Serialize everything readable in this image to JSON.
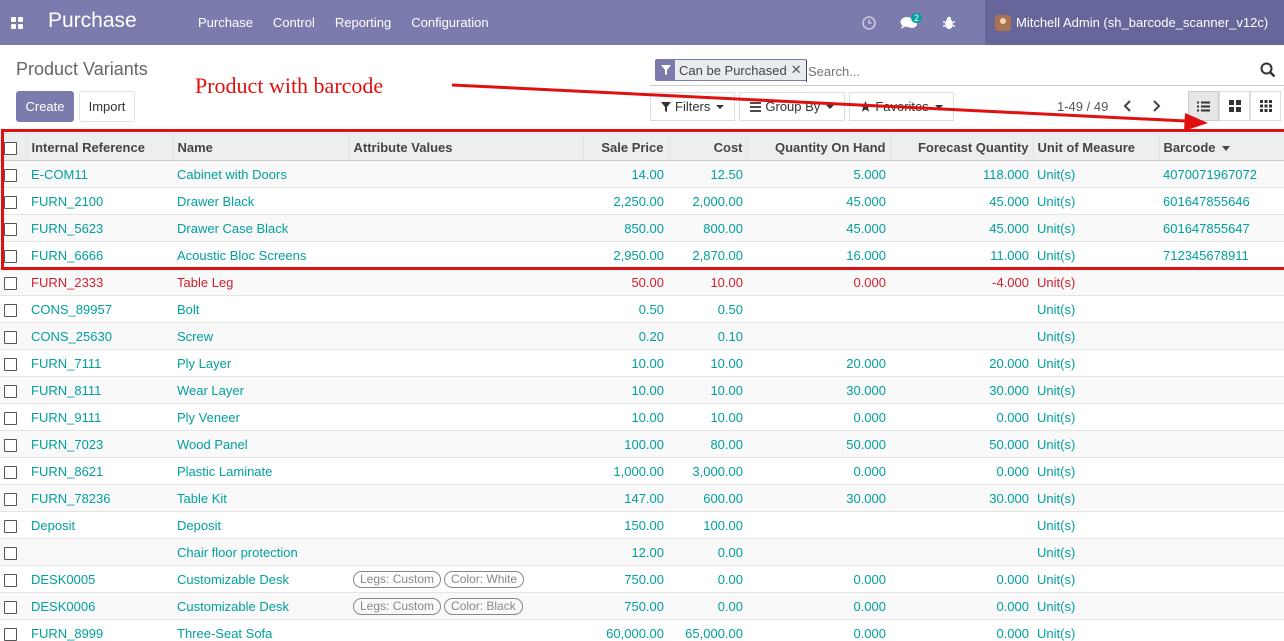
{
  "navbar": {
    "app_title": "Purchase",
    "menu": [
      "Purchase",
      "Control",
      "Reporting",
      "Configuration"
    ],
    "chat_badge": "2",
    "user_name": "Mitchell Admin (sh_barcode_scanner_v12c)",
    "bg_color": "#7c7bad"
  },
  "control_panel": {
    "breadcrumb": "Product Variants",
    "create_label": "Create",
    "import_label": "Import",
    "annotation_text": "Product with barcode",
    "search": {
      "facet": "Can be Purchased",
      "placeholder": "Search..."
    },
    "filters_label": "Filters",
    "group_by_label": "Group By",
    "favorites_label": "Favorites",
    "pager": "1-49 / 49"
  },
  "table": {
    "columns": [
      "Internal Reference",
      "Name",
      "Attribute Values",
      "Sale Price",
      "Cost",
      "Quantity On Hand",
      "Forecast Quantity",
      "Unit of Measure",
      "Barcode"
    ],
    "rows": [
      {
        "ref": "E-COM11",
        "name": "Cabinet with Doors",
        "attrs": [],
        "price": "14.00",
        "cost": "12.50",
        "qoh": "5.000",
        "forecast": "118.000",
        "uom": "Unit(s)",
        "barcode": "4070071967072",
        "danger": false
      },
      {
        "ref": "FURN_2100",
        "name": "Drawer Black",
        "attrs": [],
        "price": "2,250.00",
        "cost": "2,000.00",
        "qoh": "45.000",
        "forecast": "45.000",
        "uom": "Unit(s)",
        "barcode": "601647855646",
        "danger": false
      },
      {
        "ref": "FURN_5623",
        "name": "Drawer Case Black",
        "attrs": [],
        "price": "850.00",
        "cost": "800.00",
        "qoh": "45.000",
        "forecast": "45.000",
        "uom": "Unit(s)",
        "barcode": "601647855647",
        "danger": false
      },
      {
        "ref": "FURN_6666",
        "name": "Acoustic Bloc Screens",
        "attrs": [],
        "price": "2,950.00",
        "cost": "2,870.00",
        "qoh": "16.000",
        "forecast": "11.000",
        "uom": "Unit(s)",
        "barcode": "712345678911",
        "danger": false
      },
      {
        "ref": "FURN_2333",
        "name": "Table Leg",
        "attrs": [],
        "price": "50.00",
        "cost": "10.00",
        "qoh": "0.000",
        "forecast": "-4.000",
        "uom": "Unit(s)",
        "barcode": "",
        "danger": true
      },
      {
        "ref": "CONS_89957",
        "name": "Bolt",
        "attrs": [],
        "price": "0.50",
        "cost": "0.50",
        "qoh": "",
        "forecast": "",
        "uom": "Unit(s)",
        "barcode": "",
        "danger": false
      },
      {
        "ref": "CONS_25630",
        "name": "Screw",
        "attrs": [],
        "price": "0.20",
        "cost": "0.10",
        "qoh": "",
        "forecast": "",
        "uom": "Unit(s)",
        "barcode": "",
        "danger": false
      },
      {
        "ref": "FURN_7111",
        "name": "Ply Layer",
        "attrs": [],
        "price": "10.00",
        "cost": "10.00",
        "qoh": "20.000",
        "forecast": "20.000",
        "uom": "Unit(s)",
        "barcode": "",
        "danger": false
      },
      {
        "ref": "FURN_8111",
        "name": "Wear Layer",
        "attrs": [],
        "price": "10.00",
        "cost": "10.00",
        "qoh": "30.000",
        "forecast": "30.000",
        "uom": "Unit(s)",
        "barcode": "",
        "danger": false
      },
      {
        "ref": "FURN_9111",
        "name": "Ply Veneer",
        "attrs": [],
        "price": "10.00",
        "cost": "10.00",
        "qoh": "0.000",
        "forecast": "0.000",
        "uom": "Unit(s)",
        "barcode": "",
        "danger": false
      },
      {
        "ref": "FURN_7023",
        "name": "Wood Panel",
        "attrs": [],
        "price": "100.00",
        "cost": "80.00",
        "qoh": "50.000",
        "forecast": "50.000",
        "uom": "Unit(s)",
        "barcode": "",
        "danger": false
      },
      {
        "ref": "FURN_8621",
        "name": "Plastic Laminate",
        "attrs": [],
        "price": "1,000.00",
        "cost": "3,000.00",
        "qoh": "0.000",
        "forecast": "0.000",
        "uom": "Unit(s)",
        "barcode": "",
        "danger": false
      },
      {
        "ref": "FURN_78236",
        "name": "Table Kit",
        "attrs": [],
        "price": "147.00",
        "cost": "600.00",
        "qoh": "30.000",
        "forecast": "30.000",
        "uom": "Unit(s)",
        "barcode": "",
        "danger": false
      },
      {
        "ref": "Deposit",
        "name": "Deposit",
        "attrs": [],
        "price": "150.00",
        "cost": "100.00",
        "qoh": "",
        "forecast": "",
        "uom": "Unit(s)",
        "barcode": "",
        "danger": false
      },
      {
        "ref": "",
        "name": "Chair floor protection",
        "attrs": [],
        "price": "12.00",
        "cost": "0.00",
        "qoh": "",
        "forecast": "",
        "uom": "Unit(s)",
        "barcode": "",
        "danger": false
      },
      {
        "ref": "DESK0005",
        "name": "Customizable Desk",
        "attrs": [
          "Legs: Custom",
          "Color: White"
        ],
        "price": "750.00",
        "cost": "0.00",
        "qoh": "0.000",
        "forecast": "0.000",
        "uom": "Unit(s)",
        "barcode": "",
        "danger": false
      },
      {
        "ref": "DESK0006",
        "name": "Customizable Desk",
        "attrs": [
          "Legs: Custom",
          "Color: Black"
        ],
        "price": "750.00",
        "cost": "0.00",
        "qoh": "0.000",
        "forecast": "0.000",
        "uom": "Unit(s)",
        "barcode": "",
        "danger": false
      },
      {
        "ref": "FURN_8999",
        "name": "Three-Seat Sofa",
        "attrs": [],
        "price": "60,000.00",
        "cost": "65,000.00",
        "qoh": "0.000",
        "forecast": "0.000",
        "uom": "Unit(s)",
        "barcode": "",
        "danger": false
      }
    ]
  },
  "colors": {
    "link": "#00a09d",
    "danger": "#d01f2f",
    "annotation": "#e01010"
  }
}
